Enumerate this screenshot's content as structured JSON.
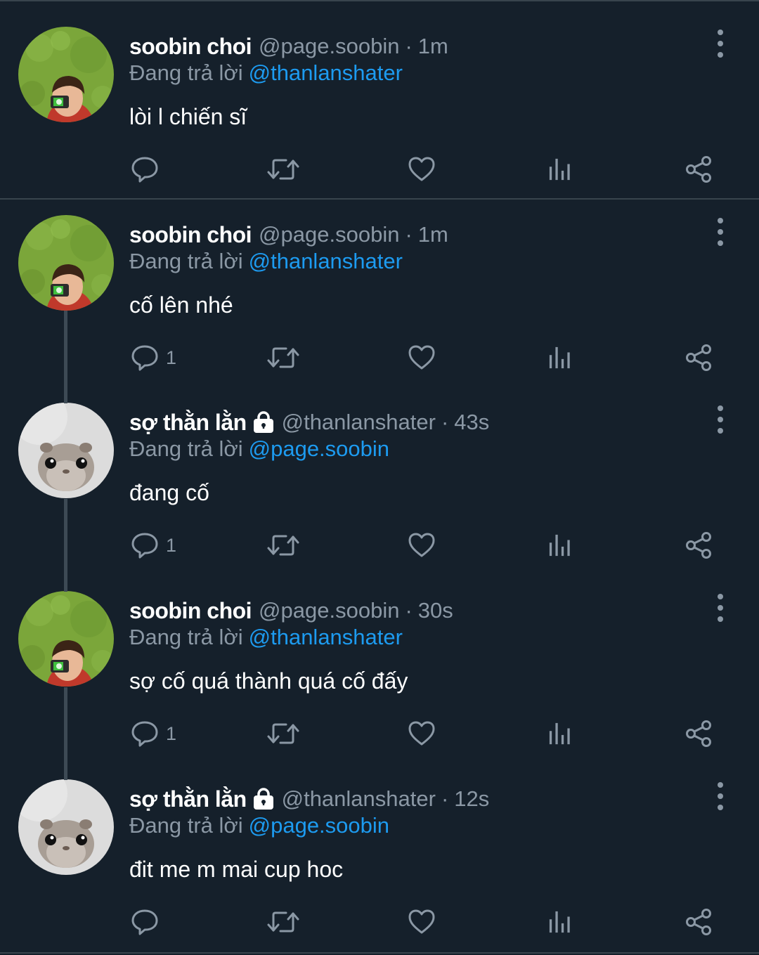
{
  "colors": {
    "background": "#15202b",
    "divider": "#38444d",
    "text_primary": "#ffffff",
    "text_secondary": "#8b98a5",
    "mention": "#1d9bf0"
  },
  "icons": {
    "reply": "speech-bubble-icon",
    "retweet": "retweet-icon",
    "like": "heart-icon",
    "views": "bar-chart-icon",
    "share": "share-icon",
    "more": "vertical-ellipsis-icon",
    "protected": "lock-icon"
  },
  "tweets": [
    {
      "display_name": "soobin choi",
      "handle": "@page.soobin",
      "separator": "·",
      "time": "1m",
      "replying_label": "Đang trả lời",
      "replying_to": "@thanlanshater",
      "text": "lòi l chiến sĩ",
      "reply_count": "",
      "avatar": "boy-on-grass"
    },
    {
      "display_name": "soobin choi",
      "handle": "@page.soobin",
      "separator": "·",
      "time": "1m",
      "replying_label": "Đang trả lời",
      "replying_to": "@thanlanshater",
      "text": "cố lên nhé",
      "reply_count": "1",
      "avatar": "boy-on-grass"
    },
    {
      "display_name": "sợ thằn lằn",
      "handle": "@thanlanshater",
      "separator": "·",
      "time": "43s",
      "replying_label": "Đang trả lời",
      "replying_to": "@page.soobin",
      "text": "đang cố",
      "reply_count": "1",
      "avatar": "hamster"
    },
    {
      "display_name": "soobin choi",
      "handle": "@page.soobin",
      "separator": "·",
      "time": "30s",
      "replying_label": "Đang trả lời",
      "replying_to": "@thanlanshater",
      "text": "sợ cố quá thành quá cố đấy",
      "reply_count": "1",
      "avatar": "boy-on-grass"
    },
    {
      "display_name": "sợ thằn lằn",
      "handle": "@thanlanshater",
      "separator": "·",
      "time": "12s",
      "replying_label": "Đang trả lời",
      "replying_to": "@page.soobin",
      "text": "đit me m mai cup hoc",
      "reply_count": "",
      "avatar": "hamster"
    }
  ]
}
